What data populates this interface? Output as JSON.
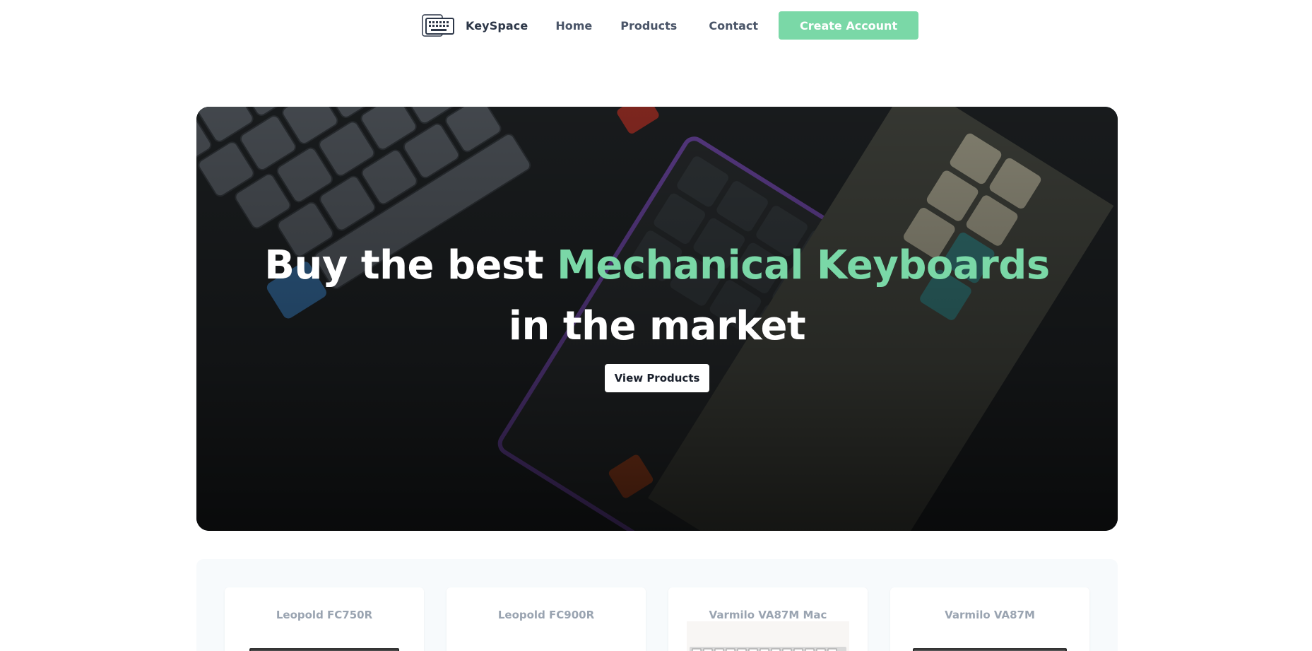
{
  "nav": {
    "brand": "KeySpace",
    "links": [
      "Home",
      "Products",
      "Contact"
    ],
    "cta": "Create Account"
  },
  "hero": {
    "title_prefix": "Buy the best ",
    "title_accent": "Mechanical Keyboards",
    "title_line2": "in the market",
    "button": "View Products"
  },
  "products": [
    {
      "name": "Leopold FC750R",
      "icon": "dark-keyboard-image"
    },
    {
      "name": "Leopold FC900R",
      "icon": "keyboard-image"
    },
    {
      "name": "Varmilo VA87M Mac",
      "icon": "white-keyboard-image"
    },
    {
      "name": "Varmilo VA87M",
      "icon": "dark-keyboard-image"
    }
  ],
  "colors": {
    "accent": "#7ad8a7",
    "text": "#2d3748",
    "muted": "#9aa4b1",
    "section_bg": "#f7fafc"
  }
}
